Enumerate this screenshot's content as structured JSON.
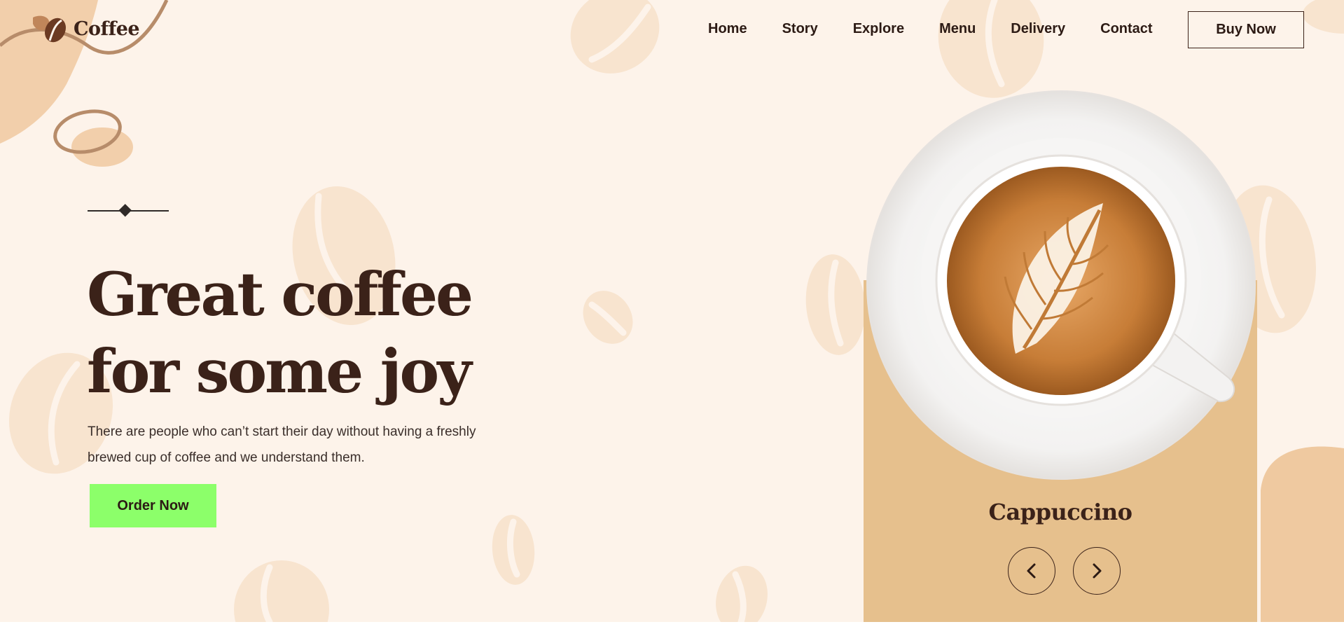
{
  "brand": {
    "name": "Coffee",
    "icon": "coffee-bean-icon"
  },
  "nav": {
    "items": [
      {
        "label": "Home"
      },
      {
        "label": "Story"
      },
      {
        "label": "Explore"
      },
      {
        "label": "Menu"
      },
      {
        "label": "Delivery"
      },
      {
        "label": "Contact"
      }
    ],
    "cta_label": "Buy Now"
  },
  "hero": {
    "headline_line1": "Great coffee",
    "headline_line2": "for some joy",
    "description": "There are people who can’t start their day without having a freshly brewed cup of coffee and we understand them.",
    "order_label": "Order Now"
  },
  "product": {
    "name": "Cappuccino",
    "prev_icon": "chevron-left-icon",
    "next_icon": "chevron-right-icon"
  },
  "colors": {
    "background": "#fdf3ea",
    "text_dark": "#3b2219",
    "accent_green": "#8cff6a",
    "card": "#e6c08d",
    "bean_decor": "#f8e4cf",
    "blob": "#efc9a0"
  }
}
